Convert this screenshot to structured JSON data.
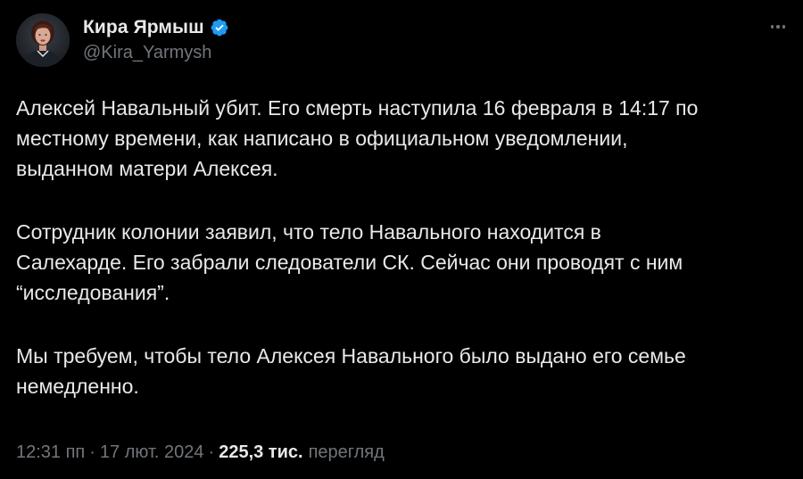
{
  "author": {
    "display_name": "Кира Ярмыш",
    "handle": "@Kira_Yarmysh",
    "verified": true,
    "avatar_icon": "profile-photo",
    "verified_color": "#1d9bf0"
  },
  "tweet": {
    "paragraphs": [
      {
        "lines": [
          "Алексей Навальный убит. Его смерть наступила 16 февраля в 14:17 по",
          "местному времени, как написано в официальном уведомлении,",
          "выданном матери Алексея."
        ]
      },
      {
        "lines": [
          "Сотрудник колонии заявил, что тело Навального находится в",
          "Салехарде. Его забрали следователи СК. Сейчас они проводят с ним",
          "“исследования”."
        ]
      },
      {
        "lines": [
          "Мы требуем, чтобы тело Алексея Навального было выдано его семье",
          "немедленно."
        ]
      }
    ]
  },
  "meta": {
    "time": "12:31 пп",
    "separator": "·",
    "date": "17 лют. 2024",
    "views_count": "225,3 тис.",
    "views_label": "перегляд"
  },
  "colors": {
    "background": "#000000",
    "text": "#e7e9ea",
    "secondary_text": "#71767b"
  },
  "more_icon": "more-horizontal-icon"
}
